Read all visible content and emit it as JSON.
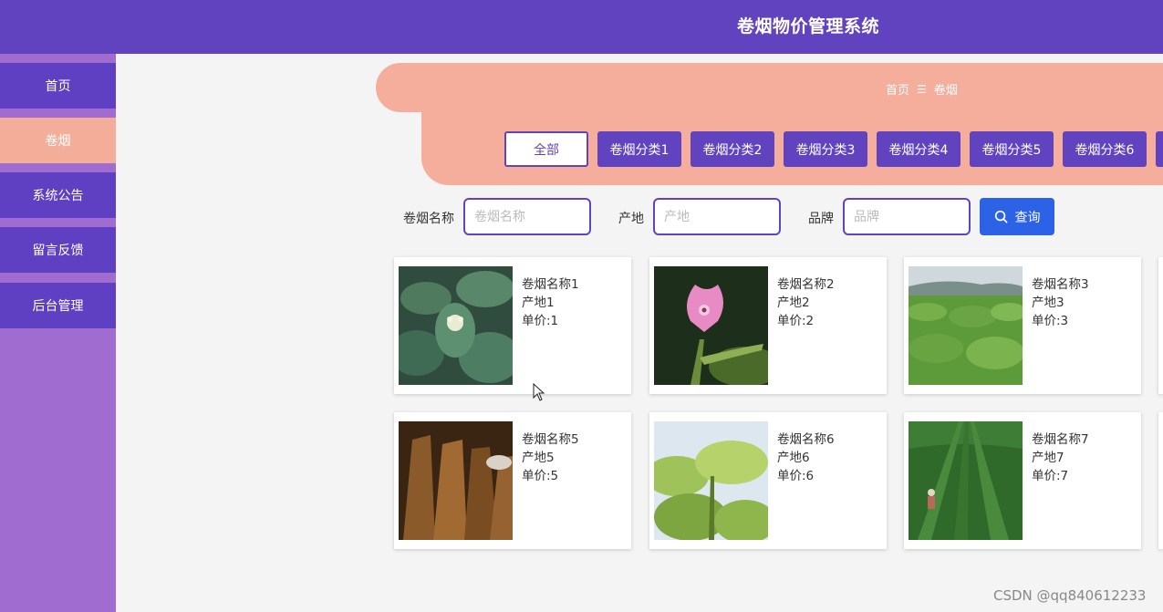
{
  "header": {
    "title": "卷烟物价管理系统"
  },
  "sidebar": {
    "items": [
      {
        "label": "首页"
      },
      {
        "label": "卷烟"
      },
      {
        "label": "系统公告"
      },
      {
        "label": "留言反馈"
      },
      {
        "label": "后台管理"
      }
    ],
    "active": "卷烟"
  },
  "breadcrumb": {
    "home": "首页",
    "separator": "☰",
    "current": "卷烟"
  },
  "categories": [
    "全部",
    "卷烟分类1",
    "卷烟分类2",
    "卷烟分类3",
    "卷烟分类4",
    "卷烟分类5",
    "卷烟分类6"
  ],
  "filters": {
    "name": {
      "label": "卷烟名称",
      "placeholder": "卷烟名称"
    },
    "origin": {
      "label": "产地",
      "placeholder": "产地"
    },
    "brand": {
      "label": "品牌",
      "placeholder": "品牌"
    },
    "query_label": "查询"
  },
  "products": [
    {
      "name": "卷烟名称1",
      "origin": "产地1",
      "price": "单价:1"
    },
    {
      "name": "卷烟名称2",
      "origin": "产地2",
      "price": "单价:2"
    },
    {
      "name": "卷烟名称3",
      "origin": "产地3",
      "price": "单价:3"
    },
    {
      "name": "卷烟名称5",
      "origin": "产地5",
      "price": "单价:5"
    },
    {
      "name": "卷烟名称6",
      "origin": "产地6",
      "price": "单价:6"
    },
    {
      "name": "卷烟名称7",
      "origin": "产地7",
      "price": "单价:7"
    }
  ],
  "watermark": "CSDN @qq840612233",
  "colors": {
    "primary": "#6143c0",
    "accent": "#f5ad9c",
    "sidebar": "#a06cd0",
    "query": "#2b62e6"
  }
}
